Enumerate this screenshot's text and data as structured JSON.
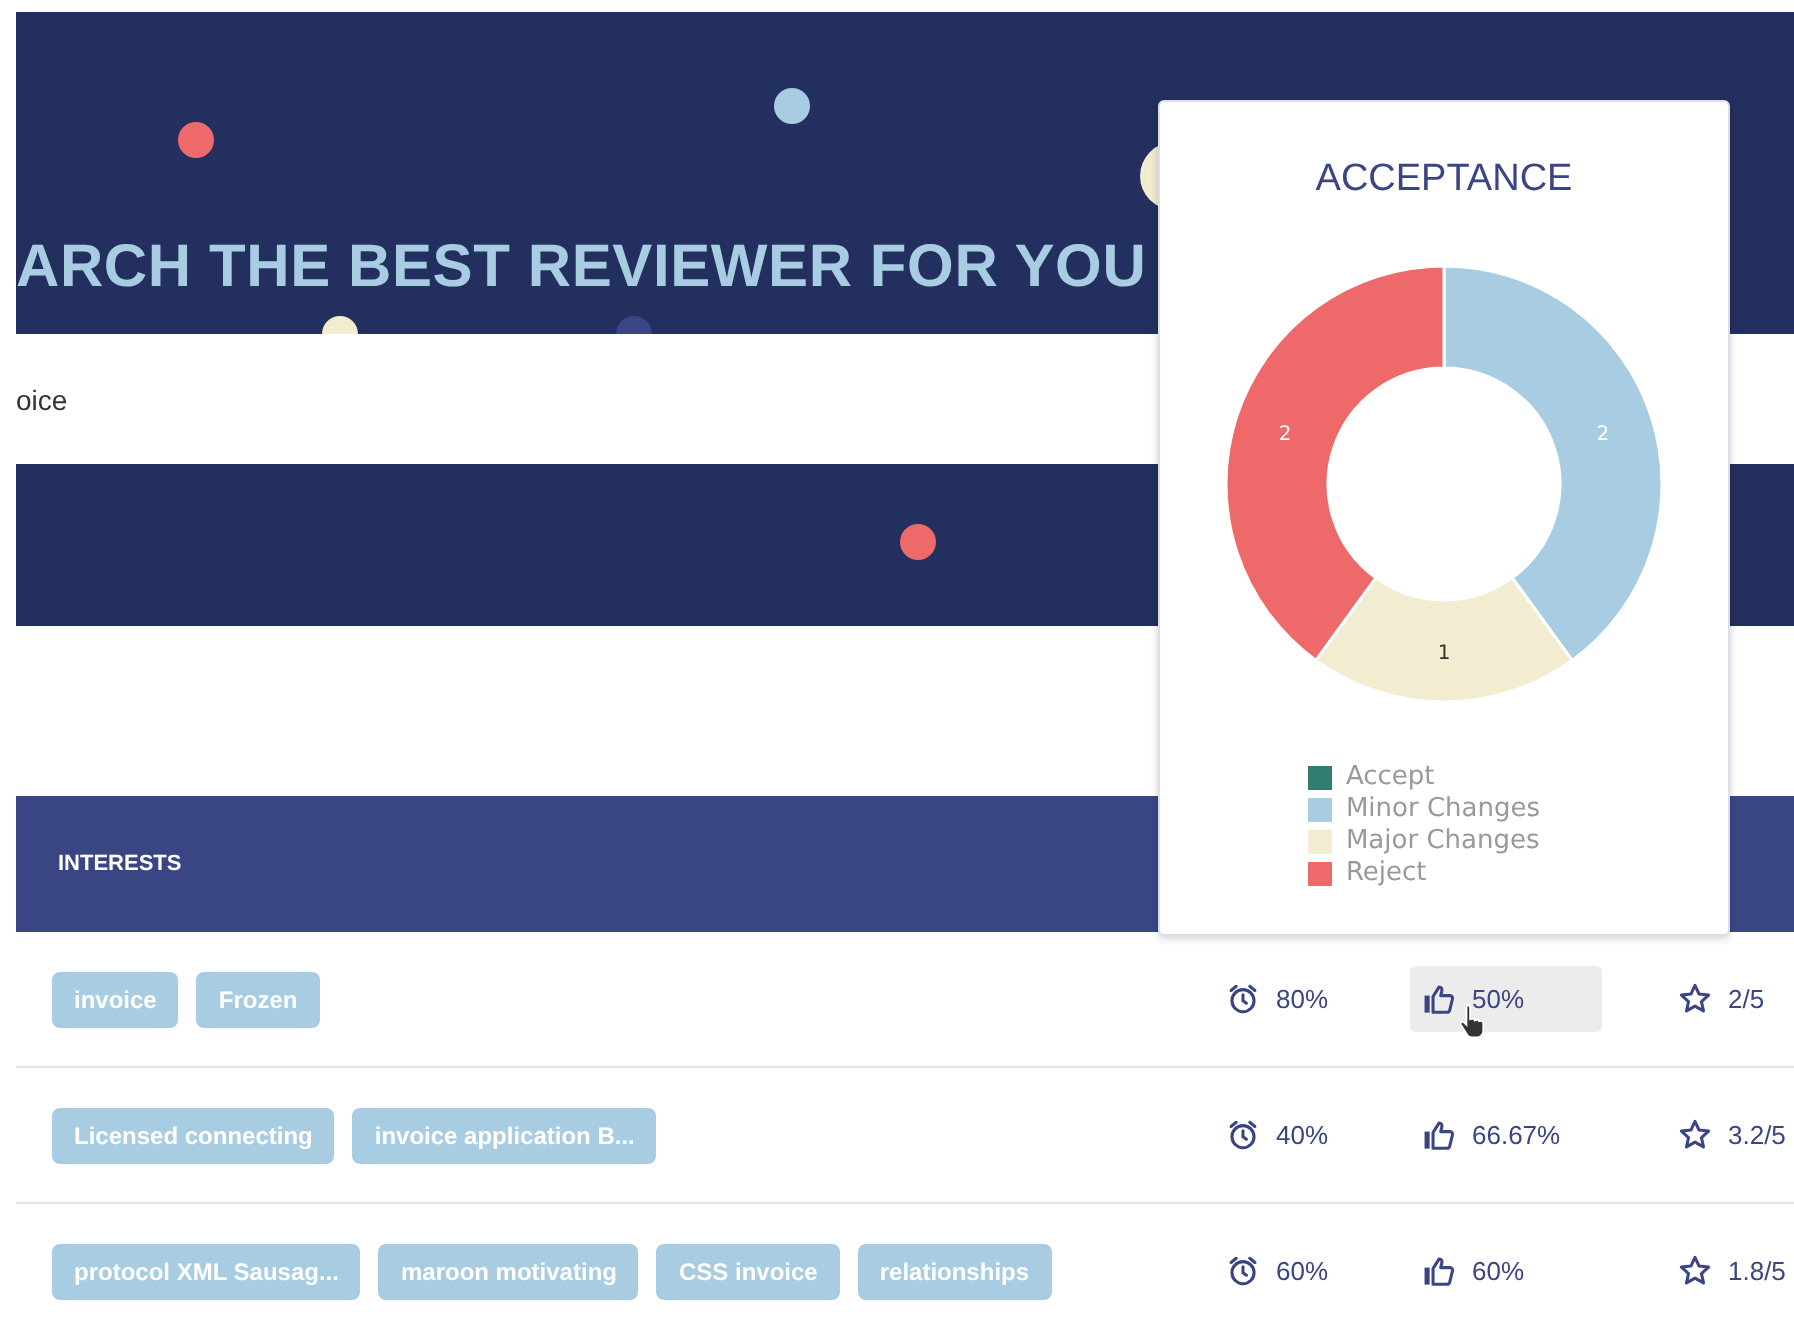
{
  "hero": {
    "title": "ARCH THE BEST REVIEWER FOR YOU"
  },
  "search": {
    "value": "oice"
  },
  "table": {
    "columns": [
      "INTERESTS"
    ],
    "rows": [
      {
        "tags": [
          "invoice",
          "Frozen"
        ],
        "timeliness": "80%",
        "acceptance": "50%",
        "acceptance_hovered": true,
        "rating": "2/5"
      },
      {
        "tags": [
          "Licensed connecting",
          "invoice application B..."
        ],
        "timeliness": "40%",
        "acceptance": "66.67%",
        "acceptance_hovered": false,
        "rating": "3.2/5"
      },
      {
        "tags": [
          "protocol XML Sausag...",
          "maroon motivating",
          "CSS invoice",
          "relationships"
        ],
        "timeliness": "60%",
        "acceptance": "60%",
        "acceptance_hovered": false,
        "rating": "1.8/5"
      }
    ]
  },
  "popover": {
    "title": "ACCEPTANCE",
    "chart_data": {
      "type": "donut",
      "categories": [
        "Accept",
        "Minor Changes",
        "Major Changes",
        "Reject"
      ],
      "values": [
        0,
        2,
        1,
        2
      ],
      "colors": [
        "#2e7d6e",
        "#a8cde2",
        "#f2ecd0",
        "#ee6a6a"
      ],
      "data_labels": true
    }
  }
}
